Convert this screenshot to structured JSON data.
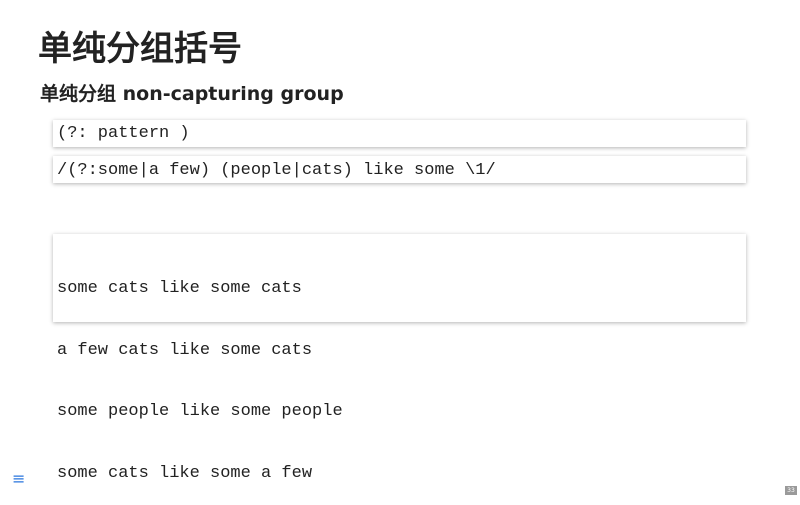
{
  "slide": {
    "title": "单纯分组括号",
    "subtitle": "单纯分组 non-capturing group",
    "syntax": "(?: pattern )",
    "regex": "/(?:some|a few) (people|cats) like some \\1/",
    "samples": [
      "some cats like some cats",
      "a few cats like some cats",
      "some people like some people",
      "some cats like some a few"
    ],
    "page_number": "33"
  },
  "nav": {
    "menu_icon": "hamburger-menu-icon",
    "menu_glyph": "≡",
    "accent_color": "#2a76dd"
  }
}
